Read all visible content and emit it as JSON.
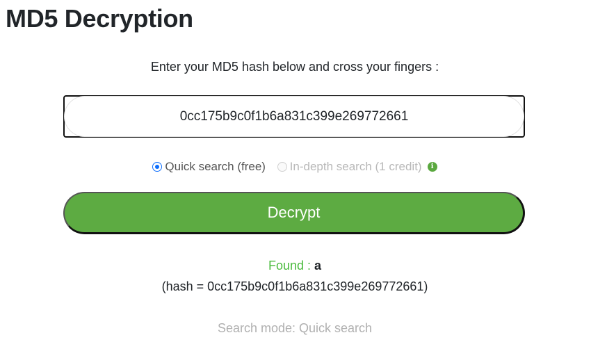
{
  "header": {
    "title": "MD5 Decryption"
  },
  "form": {
    "instructions": "Enter your MD5 hash below and cross your fingers :",
    "hash_value": "0cc175b9c0f1b6a831c399e269772661",
    "options": {
      "quick": {
        "label": "Quick search (free)",
        "checked": true
      },
      "indepth": {
        "label": "In-depth search (1 credit)",
        "disabled": true
      },
      "info_icon": "info-circle-icon"
    },
    "decrypt_label": "Decrypt"
  },
  "result": {
    "found_label": "Found :",
    "found_value": "a",
    "hash_line": "(hash = 0cc175b9c0f1b6a831c399e269772661)",
    "search_mode": "Search mode: Quick search"
  },
  "colors": {
    "button_green": "#5dab42",
    "found_green": "#4cbb3f",
    "radio_blue": "#0d6efd",
    "muted_gray": "#b0b0b0"
  }
}
